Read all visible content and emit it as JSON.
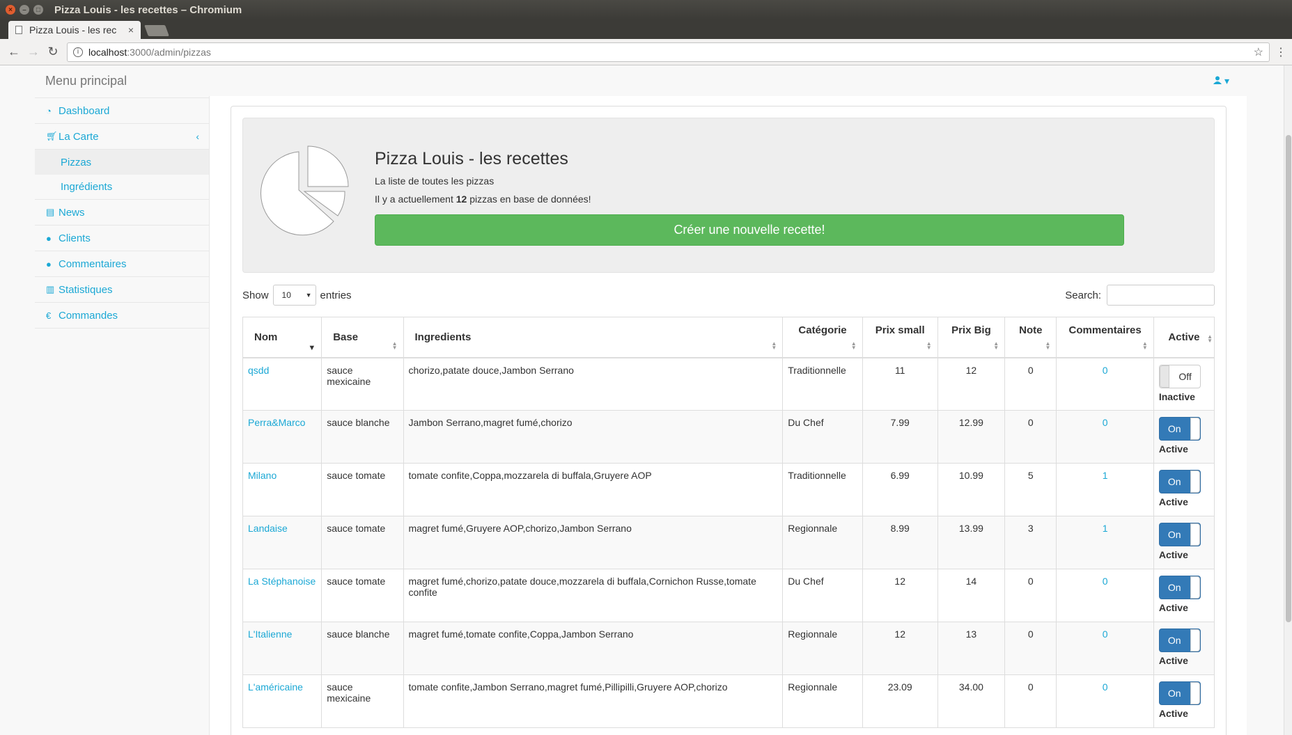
{
  "window": {
    "title": "Pizza Louis - les recettes – Chromium"
  },
  "tab": {
    "label": "Pizza Louis - les rec",
    "close": "×"
  },
  "address": {
    "host": "localhost",
    "path": ":3000/admin/pizzas"
  },
  "topnav": {
    "brand": "Menu principal",
    "user_caret": "▾"
  },
  "sidebar": {
    "dashboard": "Dashboard",
    "la_carte": "La Carte",
    "chevron": "‹",
    "pizzas": "Pizzas",
    "ingredients": "Ingrédients",
    "news": "News",
    "clients": "Clients",
    "commentaires": "Commentaires",
    "statistiques": "Statistiques",
    "commandes": "Commandes"
  },
  "jumbotron": {
    "title": "Pizza Louis - les recettes",
    "subtitle": "La liste de toutes les pizzas",
    "count_prefix": "Il y a actuellement ",
    "count": "12",
    "count_suffix": " pizzas en base de données!",
    "create_button": "Créer une nouvelle recette!"
  },
  "controls": {
    "show": "Show",
    "length": "10",
    "entries": "entries",
    "search": "Search:"
  },
  "table": {
    "headers": {
      "nom": "Nom",
      "base": "Base",
      "ingredients": "Ingredients",
      "categorie": "Catégorie",
      "prix_small": "Prix small",
      "prix_big": "Prix Big",
      "note": "Note",
      "commentaires": "Commentaires",
      "active": "Active"
    },
    "rows": [
      {
        "nom": "qsdd",
        "base": "sauce mexicaine",
        "ingredients": "chorizo,patate douce,Jambon Serrano",
        "categorie": "Traditionnelle",
        "prix_small": "11",
        "prix_big": "12",
        "note": "0",
        "commentaires": "0",
        "toggle": "Off",
        "status": "Inactive"
      },
      {
        "nom": "Perra&Marco",
        "base": "sauce blanche",
        "ingredients": "Jambon Serrano,magret fumé,chorizo",
        "categorie": "Du Chef",
        "prix_small": "7.99",
        "prix_big": "12.99",
        "note": "0",
        "commentaires": "0",
        "toggle": "On",
        "status": "Active"
      },
      {
        "nom": "Milano",
        "base": "sauce tomate",
        "ingredients": "tomate confite,Coppa,mozzarela di buffala,Gruyere AOP",
        "categorie": "Traditionnelle",
        "prix_small": "6.99",
        "prix_big": "10.99",
        "note": "5",
        "commentaires": "1",
        "toggle": "On",
        "status": "Active"
      },
      {
        "nom": "Landaise",
        "base": "sauce tomate",
        "ingredients": "magret fumé,Gruyere AOP,chorizo,Jambon Serrano",
        "categorie": "Regionnale",
        "prix_small": "8.99",
        "prix_big": "13.99",
        "note": "3",
        "commentaires": "1",
        "toggle": "On",
        "status": "Active"
      },
      {
        "nom": "La Stéphanoise",
        "base": "sauce tomate",
        "ingredients": "magret fumé,chorizo,patate douce,mozzarela di buffala,Cornichon Russe,tomate confite",
        "categorie": "Du Chef",
        "prix_small": "12",
        "prix_big": "14",
        "note": "0",
        "commentaires": "0",
        "toggle": "On",
        "status": "Active"
      },
      {
        "nom": "L'Italienne",
        "base": "sauce blanche",
        "ingredients": "magret fumé,tomate confite,Coppa,Jambon Serrano",
        "categorie": "Regionnale",
        "prix_small": "12",
        "prix_big": "13",
        "note": "0",
        "commentaires": "0",
        "toggle": "On",
        "status": "Active"
      },
      {
        "nom": "L'américaine",
        "base": "sauce mexicaine",
        "ingredients": "tomate confite,Jambon Serrano,magret fumé,Pillipilli,Gruyere AOP,chorizo",
        "categorie": "Regionnale",
        "prix_small": "23.09",
        "prix_big": "34.00",
        "note": "0",
        "commentaires": "0",
        "toggle": "On",
        "status": "Active"
      }
    ]
  },
  "colors": {
    "link": "#1ba8d5",
    "success": "#5cb85c",
    "primary": "#337ab7"
  }
}
